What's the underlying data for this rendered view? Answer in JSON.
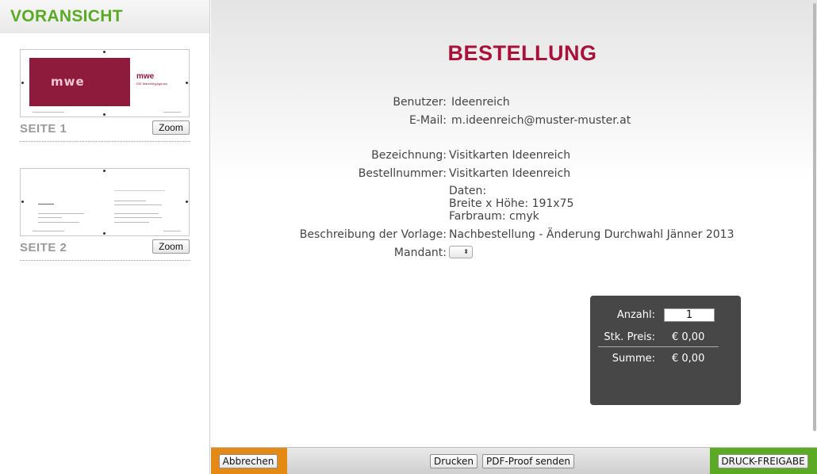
{
  "sidebar": {
    "title": "VORANSICHT",
    "pages": [
      {
        "label": "SEITE 1",
        "zoom_label": "Zoom",
        "thumb_logo": "mwe",
        "thumb_logo_right": "mwe",
        "thumb_sub": "DIE MarketingAgentur"
      },
      {
        "label": "SEITE 2",
        "zoom_label": "Zoom"
      }
    ]
  },
  "main": {
    "title": "BESTELLUNG",
    "fields": [
      {
        "label": "Benutzer:",
        "value": "Ideenreich"
      },
      {
        "label": "E-Mail:",
        "value": "m.ideenreich@muster-muster.at"
      },
      {
        "label": "Bezeichnung:",
        "value": "Visitkarten Ideenreich"
      },
      {
        "label": "Bestellnummer:",
        "value": "Visitkarten Ideenreich"
      },
      {
        "label": "",
        "value": "Daten:"
      },
      {
        "label": "",
        "value": "Breite x Höhe: 191x75"
      },
      {
        "label": "",
        "value": "Farbraum: cmyk"
      },
      {
        "label": "Beschreibung der Vorlage:",
        "value": "Nachbestellung - Änderung Durchwahl Jänner 2013"
      },
      {
        "label": "Mandant:",
        "value": ""
      }
    ],
    "mandant_select_glyph": "⬍"
  },
  "summary": {
    "qty_label": "Anzahl:",
    "qty_value": "1",
    "unit_price_label": "Stk. Preis:",
    "unit_price_value": "€ 0,00",
    "total_label": "Summe:",
    "total_value": "€ 0,00"
  },
  "footer": {
    "cancel_label": "Abbrechen",
    "print_label": "Drucken",
    "pdf_proof_label": "PDF-Proof senden",
    "approve_label": "DRUCK-FREIGABE"
  },
  "colors": {
    "brand_green": "#5aab23",
    "title_red": "#a8123a",
    "cancel_orange": "#e48a14",
    "panel_dark": "#474747"
  }
}
